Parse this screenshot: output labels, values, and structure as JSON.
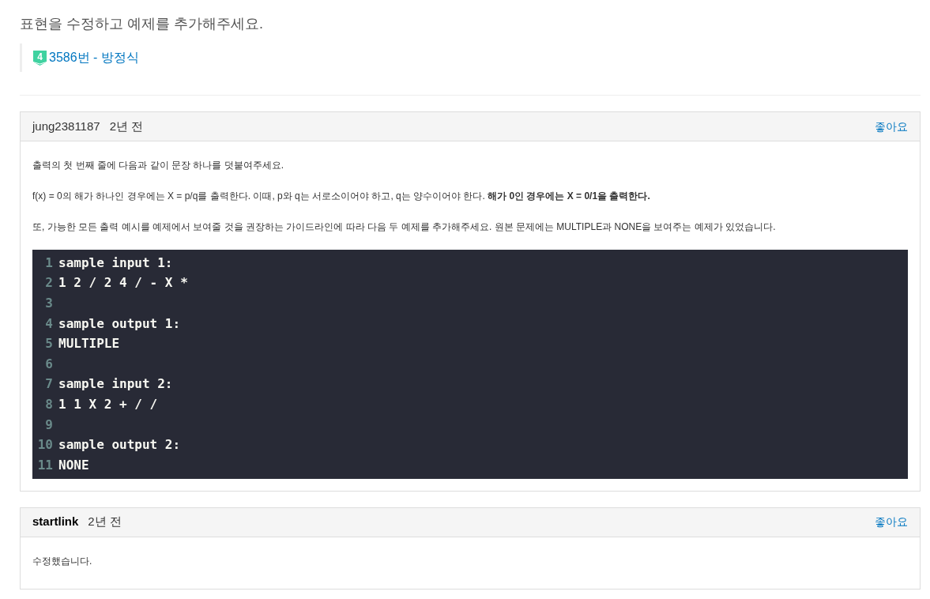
{
  "post": {
    "title": "표현을 수정하고 예제를 추가해주세요.",
    "problem": {
      "level": "4",
      "link": "3586번 - 방정식"
    }
  },
  "comments": [
    {
      "author": "jung2381187",
      "author_bold": false,
      "time": "2년 전",
      "like": "좋아요",
      "body": [
        {
          "kind": "paragraph",
          "text": "출력의 첫 번째 줄에 다음과 같이 문장 하나를 덧붙여주세요."
        },
        {
          "kind": "paragraph",
          "text": "f(x) = 0의 해가 하나인 경우에는 X = p/q를 출력한다. 이때, p와 q는 서로소이어야 하고, q는 양수이어야 한다. **해가 0인 경우에는 X = 0/1을 출력한다.**"
        },
        {
          "kind": "paragraph",
          "text": "또, 가능한 모든 출력 예시를 예제에서 보여줄 것을 권장하는 가이드라인에 따라 다음 두 예제를 추가해주세요. 원본 문제에는 MULTIPLE과 NONE을 보여주는 예제가 있었습니다."
        },
        {
          "kind": "code",
          "lines": [
            {
              "number": "1",
              "text": "sample input 1:"
            },
            {
              "number": "2",
              "text": "1 2 / 2 4 / - X *"
            },
            {
              "number": "3"
            },
            {
              "number": "4",
              "text": "sample output 1:"
            },
            {
              "number": "5",
              "text": "MULTIPLE"
            },
            {
              "number": "6"
            },
            {
              "number": "7",
              "text": "sample input 2:"
            },
            {
              "number": "8",
              "text": "1 1 X 2 + / /"
            },
            {
              "number": "9"
            },
            {
              "number": "10",
              "text": "sample output 2:"
            },
            {
              "number": "11",
              "text": "NONE"
            }
          ]
        }
      ]
    },
    {
      "author": "startlink",
      "author_bold": true,
      "time": "2년 전",
      "like": "좋아요",
      "body": [
        {
          "kind": "paragraph",
          "text": "수정했습니다."
        }
      ]
    }
  ]
}
